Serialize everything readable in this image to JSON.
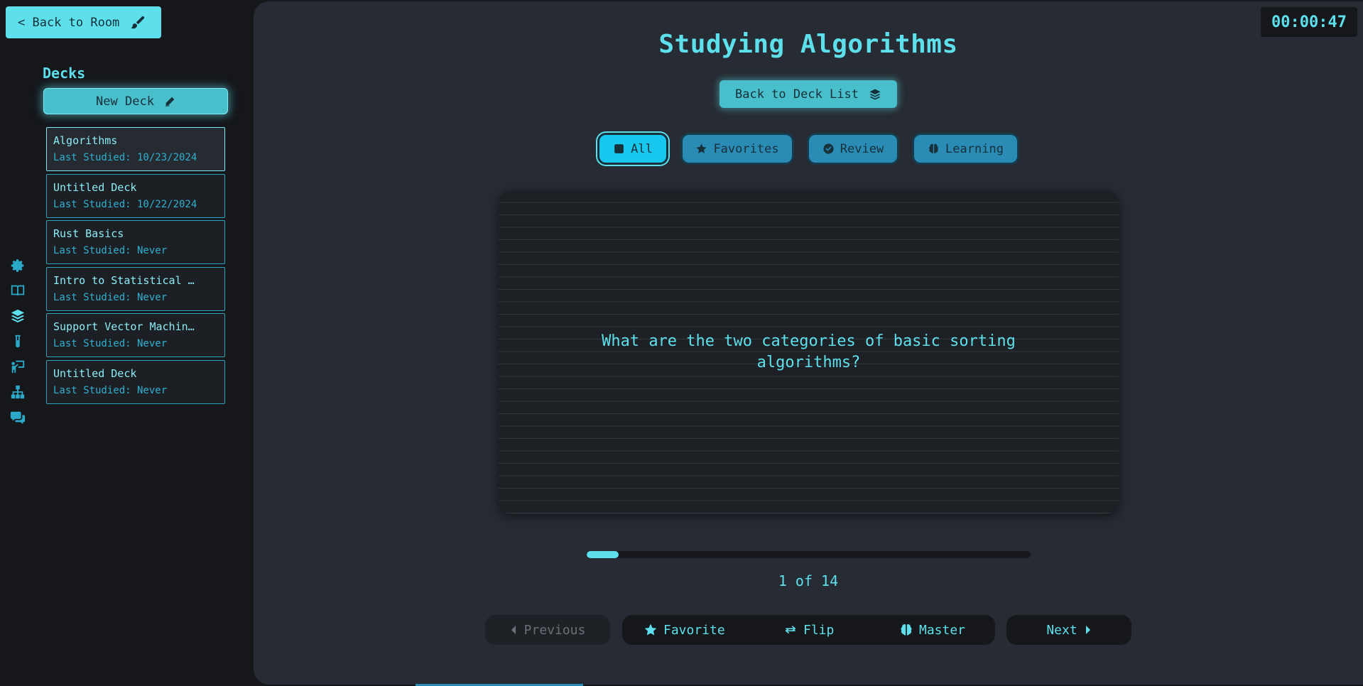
{
  "sidebar": {
    "back_to_room": "< Back to Room",
    "decks_title": "Decks",
    "new_deck": "New Deck",
    "decks": [
      {
        "name": "Algorithms",
        "last_studied": "Last Studied: 10/23/2024",
        "active": true
      },
      {
        "name": "Untitled Deck",
        "last_studied": "Last Studied: 10/22/2024",
        "active": false
      },
      {
        "name": "Rust Basics",
        "last_studied": "Last Studied: Never",
        "active": false
      },
      {
        "name": "Intro to Statistical …",
        "last_studied": "Last Studied: Never",
        "active": false
      },
      {
        "name": "Support Vector Machin…",
        "last_studied": "Last Studied: Never",
        "active": false
      },
      {
        "name": "Untitled Deck",
        "last_studied": "Last Studied: Never",
        "active": false
      }
    ]
  },
  "rail_icons": [
    "gear-icon",
    "book-icon",
    "layers-icon",
    "flask-icon",
    "presenter-icon",
    "sitemap-icon",
    "chat-icon"
  ],
  "timer": "00:00:47",
  "main": {
    "title": "Studying Algorithms",
    "back_to_deck_list": "Back to Deck List",
    "filters": [
      {
        "label": "All",
        "icon": "square-icon",
        "active": true
      },
      {
        "label": "Favorites",
        "icon": "star-icon",
        "active": false
      },
      {
        "label": "Review",
        "icon": "check-circle-icon",
        "active": false
      },
      {
        "label": "Learning",
        "icon": "brain-icon",
        "active": false
      }
    ],
    "card_text": "What are the two categories of basic sorting algorithms?",
    "progress": {
      "current": 1,
      "total": 14,
      "fraction": 0.0714
    },
    "counter": "1 of 14",
    "nav": {
      "previous": "Previous",
      "favorite": "Favorite",
      "flip": "Flip",
      "master": "Master",
      "next": "Next"
    }
  },
  "colors": {
    "accent": "#5de0ec",
    "accent_dark": "#2a8bb4",
    "panel": "#272b33",
    "background": "#15171b"
  }
}
